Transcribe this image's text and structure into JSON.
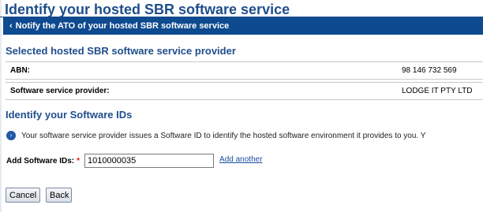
{
  "page": {
    "title": "Identify your hosted SBR software service"
  },
  "nav": {
    "back_label": "Notify the ATO of your hosted SBR software service"
  },
  "provider_section": {
    "heading": "Selected hosted SBR software service provider",
    "rows": [
      {
        "label": "ABN:",
        "value": "98 146 732 569"
      },
      {
        "label": "Software service provider:",
        "value": "LODGE IT PTY LTD"
      }
    ]
  },
  "ids_section": {
    "heading": "Identify your Software IDs",
    "info_text": "Your software service provider issues a Software ID to identify the hosted software environment it provides to you. Y",
    "field_label": "Add Software IDs:",
    "required_marker": "*",
    "field_value": "1010000035",
    "add_another_label": "Add another"
  },
  "buttons": {
    "cancel_label": "Cancel",
    "back_label": "Back"
  },
  "icons": {
    "nav_chevron": "chevron-left-icon",
    "info": "info-icon"
  },
  "colors": {
    "title": "#1f4e8c",
    "nav_bar": "#0e4a8f",
    "link": "#1a4fa0",
    "required": "#dd1111"
  }
}
